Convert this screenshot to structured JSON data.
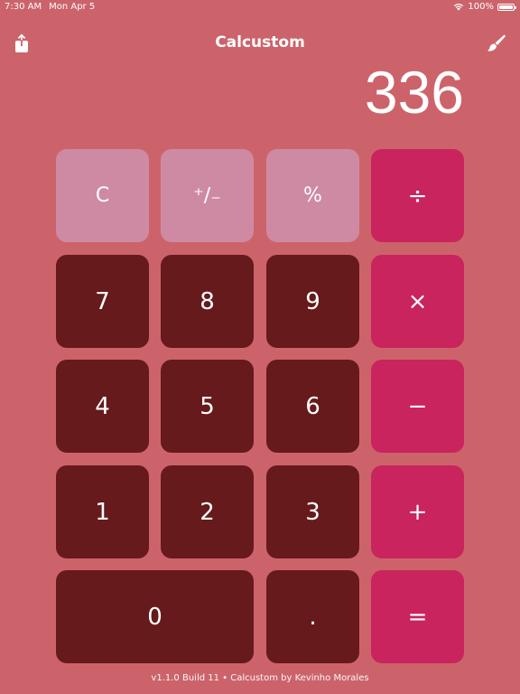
{
  "status_bar": {
    "time": "7:30 AM",
    "date": "Mon Apr 5",
    "battery": "100%"
  },
  "nav": {
    "title": "Calcustom",
    "share_icon": "share-icon",
    "theme_icon": "paintbrush-icon"
  },
  "display": {
    "value": "336"
  },
  "keys": {
    "clear": "C",
    "sign": "⁺∕₋",
    "percent": "%",
    "divide": "÷",
    "seven": "7",
    "eight": "8",
    "nine": "9",
    "multiply": "×",
    "four": "4",
    "five": "5",
    "six": "6",
    "subtract": "−",
    "one": "1",
    "two": "2",
    "three": "3",
    "add": "+",
    "zero": "0",
    "decimal": ".",
    "equals": "="
  },
  "footer": {
    "text": "v1.1.0 Build 11 • Calcustom by Kevinho Morales"
  },
  "colors": {
    "background": "#CC636B",
    "function_key": "#CF8AA3",
    "number_key": "#661A1B",
    "operator_key": "#C9245D"
  }
}
